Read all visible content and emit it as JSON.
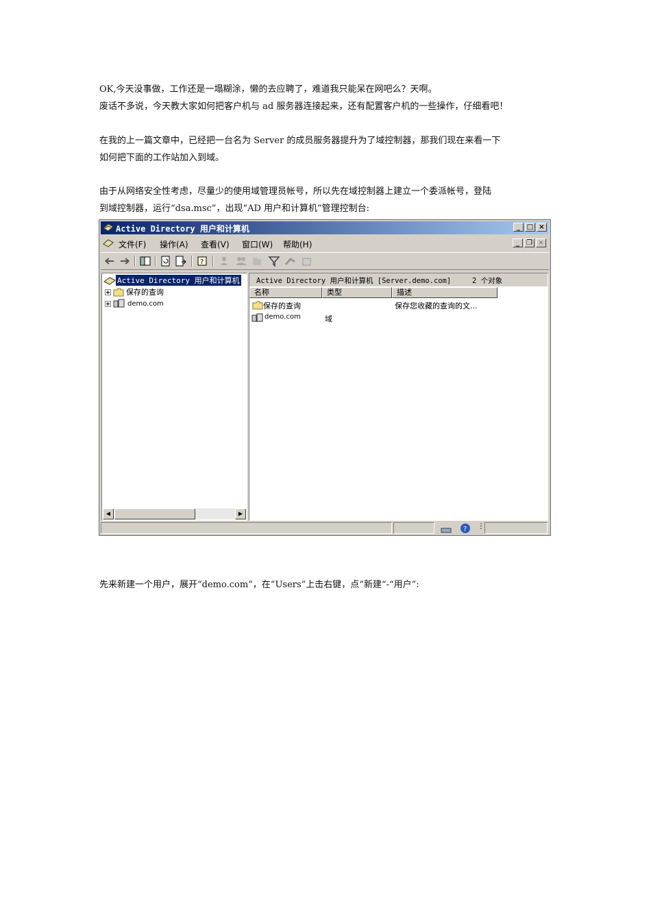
{
  "paragraphs": {
    "p1": {
      "line1": "OK,今天没事做，工作还是一塌糊涂，懒的去应聘了，难道我只能呆在网吧么？天啊。",
      "line2": "废话不多说，今天教大家如何把客户机与 ad 服务器连接起来，还有配置客户机的一些操作，仔细看吧！"
    },
    "p2": {
      "line1": "在我的上一篇文章中，已经把一台名为 Server 的成员服务器提升为了域控制器，那我们现在来看一下",
      "line2": "如何把下面的工作站加入到域。"
    },
    "p3": {
      "line1": "由于从网络安全性考虑，尽量少的使用域管理员帐号，所以先在域控制器上建立一个委派帐号，登陆",
      "line2": "到域控制器，运行“dsa.msc”，出现“AD 用户和计算机”管理控制台:"
    },
    "p4": {
      "line1": "先来新建一个用户，展开“demo.com”，在“Users”上击右键，点“新建”-“用户”:"
    }
  },
  "window": {
    "title": "Active Directory 用户和计算机",
    "menus": [
      "文件(F)",
      "操作(A)",
      "查看(V)",
      "窗口(W)",
      "帮助(H)"
    ],
    "tree": {
      "root": "Active Directory 用户和计算机",
      "items": [
        "保存的查询",
        "demo.com"
      ]
    },
    "right_header": {
      "path": "Active Directory 用户和计算机 [Server.demo.com]",
      "count": "2 个对象"
    },
    "columns": [
      "名称",
      "类型",
      "描述"
    ],
    "rows": [
      {
        "name": "保存的查询",
        "type": "",
        "desc": "保存您收藏的查询的文..."
      },
      {
        "name": "demo.com",
        "type": "域",
        "desc": ""
      }
    ]
  },
  "colors": {
    "titlebar": "#0a246a",
    "face": "#d4d0c8",
    "selection": "#0a246a"
  }
}
